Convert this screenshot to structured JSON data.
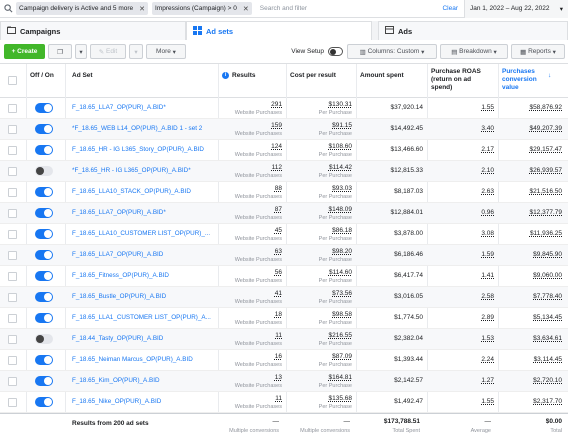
{
  "filters": [
    {
      "label": "Campaign delivery is Active and 5 more"
    },
    {
      "label": "Impressions (Campaign) > 0"
    }
  ],
  "search_placeholder": "Search and filter",
  "clear_label": "Clear",
  "date_range": "Jan 1, 2022 – Aug 22, 2022",
  "tabs": {
    "campaigns": "Campaigns",
    "adsets": "Ad sets",
    "ads": "Ads"
  },
  "toolbar": {
    "create": "+ Create",
    "edit": "Edit",
    "more": "More",
    "view_setup": "View Setup",
    "columns": "Columns: Custom",
    "breakdown": "Breakdown",
    "reports": "Reports"
  },
  "columns": {
    "offon": "Off / On",
    "adset": "Ad Set",
    "results": "Results",
    "cpr": "Cost per result",
    "spent": "Amount spent",
    "roas": "Purchase ROAS (return on ad spend)",
    "pcv": "Purchases conversion value"
  },
  "rows": [
    {
      "name": "F_18.65_LLA7_OP(PUR)_A.BID*",
      "on": true,
      "results": "291",
      "cpr": "$130.31",
      "spent": "$37,920.14",
      "roas": "1.55",
      "pcv": "$58,876.92"
    },
    {
      "name": "*F_18.65_WEB L14_OP(PUR)_A.BID 1 - set 2",
      "on": true,
      "results": "159",
      "cpr": "$91.15",
      "spent": "$14,492.45",
      "roas": "3.40",
      "pcv": "$49,207.39"
    },
    {
      "name": "F_18.65_HR - IG L365_Story_OP(PUR)_A.BID",
      "on": true,
      "results": "124",
      "cpr": "$108.60",
      "spent": "$13,466.60",
      "roas": "2.17",
      "pcv": "$29,157.47"
    },
    {
      "name": "*F_18.65_HR - IG L365_OP(PUR)_A.BID*",
      "on": false,
      "results": "112",
      "cpr": "$114.42",
      "spent": "$12,815.33",
      "roas": "2.10",
      "pcv": "$26,939.57"
    },
    {
      "name": "F_18.65_LLA10_STACK_OP(PUR)_A.BID",
      "on": true,
      "results": "88",
      "cpr": "$93.03",
      "spent": "$8,187.03",
      "roas": "2.63",
      "pcv": "$21,516.50"
    },
    {
      "name": "F_18.65_LLA7_OP(PUR)_A.BID*",
      "on": true,
      "results": "87",
      "cpr": "$148.09",
      "spent": "$12,884.01",
      "roas": "0.96",
      "pcv": "$12,377.79"
    },
    {
      "name": "F_18.65_LLA10_CUSTOMER LIST_OP(PUR)_...",
      "on": true,
      "results": "45",
      "cpr": "$86.18",
      "spent": "$3,878.00",
      "roas": "3.08",
      "pcv": "$11,936.25"
    },
    {
      "name": "F_18.65_LLA7_OP(PUR)_A.BID",
      "on": true,
      "results": "63",
      "cpr": "$98.20",
      "spent": "$6,186.46",
      "roas": "1.59",
      "pcv": "$9,845.90"
    },
    {
      "name": "F_18.65_Fitness_OP(PUR)_A.BID",
      "on": true,
      "results": "56",
      "cpr": "$114.60",
      "spent": "$6,417.74",
      "roas": "1.41",
      "pcv": "$9,060.00"
    },
    {
      "name": "F_18.65_Bustle_OP(PUR)_A.BID",
      "on": true,
      "results": "41",
      "cpr": "$73.56",
      "spent": "$3,016.05",
      "roas": "2.58",
      "pcv": "$7,778.40"
    },
    {
      "name": "F_18.65_LLA1_CUSTOMER LIST_OP(PUR)_A...",
      "on": true,
      "results": "18",
      "cpr": "$98.58",
      "spent": "$1,774.50",
      "roas": "2.89",
      "pcv": "$5,134.45"
    },
    {
      "name": "F_18.44_Tasty_OP(PUR)_A.BID",
      "on": false,
      "results": "11",
      "cpr": "$216.55",
      "spent": "$2,382.04",
      "roas": "1.53",
      "pcv": "$3,634.61"
    },
    {
      "name": "F_18.65_Neiman Marcus_OP(PUR)_A.BID",
      "on": true,
      "results": "16",
      "cpr": "$87.09",
      "spent": "$1,393.44",
      "roas": "2.24",
      "pcv": "$3,114.45"
    },
    {
      "name": "F_18.65_Kim_OP(PUR)_A.BID",
      "on": true,
      "results": "13",
      "cpr": "$164.81",
      "spent": "$2,142.57",
      "roas": "1.27",
      "pcv": "$2,720.10"
    },
    {
      "name": "F_18.65_Nike_OP(PUR)_A.BID",
      "on": true,
      "results": "11",
      "cpr": "$135.68",
      "spent": "$1,492.47",
      "roas": "1.55",
      "pcv": "$2,317.70"
    }
  ],
  "sub": {
    "results": "Website Purchases",
    "cpr": "Per Purchase"
  },
  "footer": {
    "label": "Results from 200 ad sets",
    "results": "—",
    "results_sub": "Multiple conversions",
    "cpr": "—",
    "cpr_sub": "Multiple conversions",
    "spent": "$173,788.51",
    "spent_sub": "Total Spent",
    "roas": "—",
    "roas_sub": "Average",
    "pcv": "$0.00",
    "pcv_sub": "Total"
  }
}
